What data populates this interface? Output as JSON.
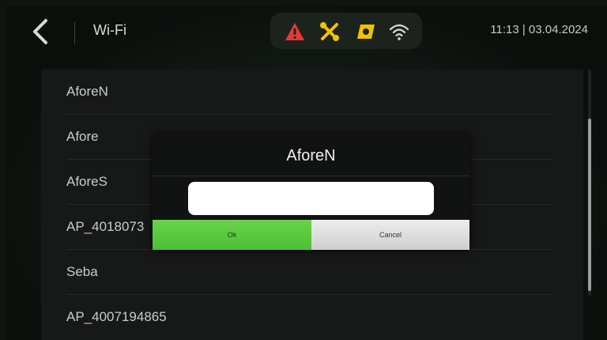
{
  "header": {
    "back_icon": "chevron-left-icon",
    "title": "Wi-Fi",
    "status_icons": [
      {
        "name": "warning-icon",
        "color": "#e53935"
      },
      {
        "name": "tools-icon",
        "color": "#f2c200"
      },
      {
        "name": "engine-icon",
        "color": "#f2c200"
      },
      {
        "name": "wifi-icon",
        "color": "#d9d9d9"
      }
    ],
    "datetime": "11:13 | 03.04.2024"
  },
  "networks": [
    {
      "label": "AforeN"
    },
    {
      "label": "Afore"
    },
    {
      "label": "AforeS"
    },
    {
      "label": "AP_4018073"
    },
    {
      "label": "Seba"
    },
    {
      "label": "AP_4007194865"
    }
  ],
  "dialog": {
    "title": "AforeN",
    "password_value": "",
    "ok_label": "Ok",
    "cancel_label": "Cancel",
    "ok_color": "#55c83b"
  }
}
